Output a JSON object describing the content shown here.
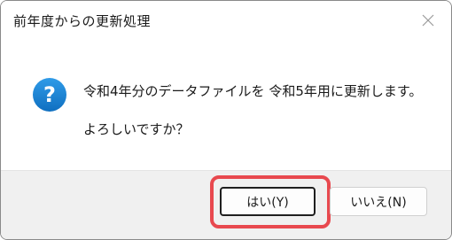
{
  "window": {
    "title": "前年度からの更新処理",
    "close_icon": "close-icon"
  },
  "message": {
    "icon": "question-icon",
    "line1": "令和4年分のデータファイルを 令和5年用に更新します。",
    "line2": "よろしいですか？"
  },
  "buttons": {
    "yes_label": "はい(Y)",
    "no_label": "いいえ(N)"
  },
  "colors": {
    "icon_blue": "#1b86d6",
    "highlight_red": "#e8494f",
    "footer_bg": "#f0f0f0"
  }
}
